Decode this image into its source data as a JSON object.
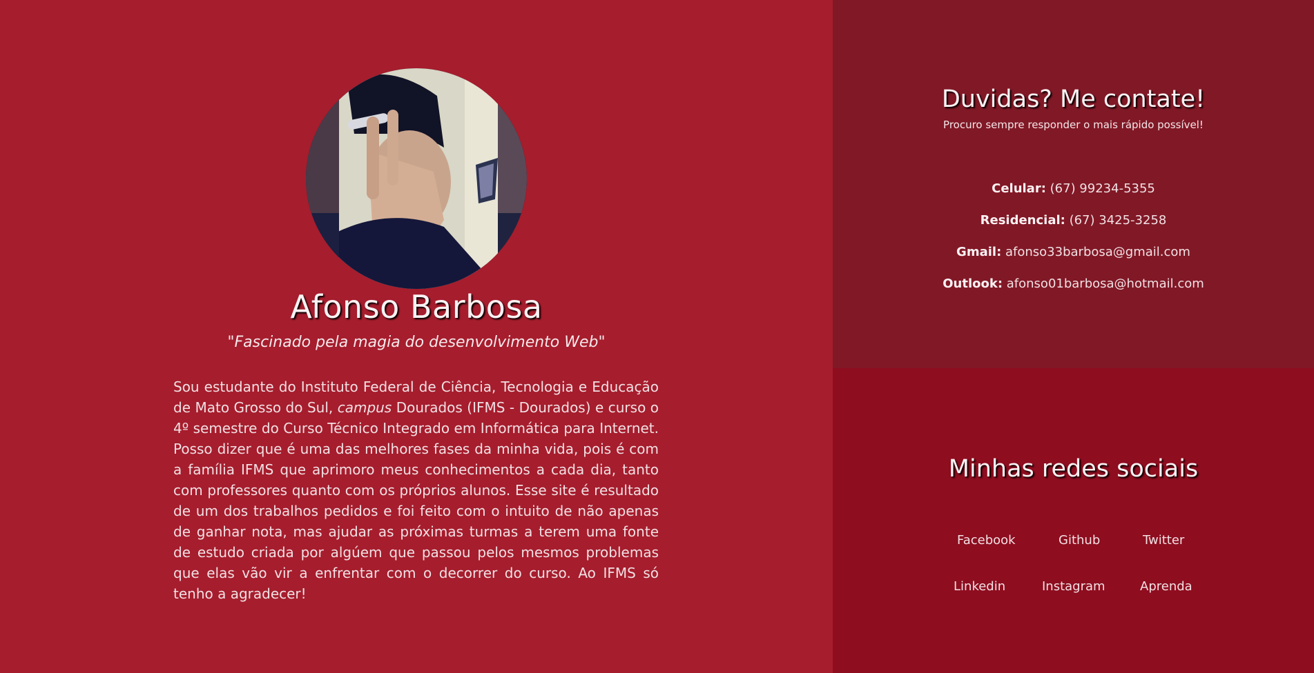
{
  "profile": {
    "name": "Afonso Barbosa",
    "tagline": "\"Fascinado pela magia do desenvolvimento Web\"",
    "bio_part1": "Sou estudante do Instituto Federal de Ciência, Tecnologia e Educação de Mato Grosso do Sul, ",
    "bio_emphasis": "campus",
    "bio_part2": " Dourados (IFMS - Dourados) e curso o 4º semestre do Curso Técnico Integrado em Informática para Internet. Posso dizer que é uma das melhores fases da minha vida, pois é com a família IFMS que aprimoro meus conhecimentos a cada dia, tanto com professores quanto com os próprios alunos. Esse site é resultado de um dos trabalhos pedidos e foi feito com o intuito de não apenas de ganhar nota, mas ajudar as próximas turmas a terem uma fonte de estudo criada por algúem que passou pelos mesmos problemas que elas vão vir a enfrentar com o decorrer do curso. Ao IFMS só tenho a agradecer!"
  },
  "contact": {
    "title": "Duvidas? Me contate!",
    "subtitle": "Procuro sempre responder o mais rápido possível!",
    "celular_label": "Celular:",
    "celular_value": "(67) 99234-5355",
    "residencial_label": "Residencial:",
    "residencial_value": "(67) 3425-3258",
    "gmail_label": "Gmail:",
    "gmail_value": "afonso33barbosa@gmail.com",
    "outlook_label": "Outlook:",
    "outlook_value": "afonso01barbosa@hotmail.com"
  },
  "social": {
    "title": "Minhas redes sociais",
    "facebook": "Facebook",
    "github": "Github",
    "twitter": "Twitter",
    "linkedin": "Linkedin",
    "instagram": "Instagram",
    "aprenda": "Aprenda"
  },
  "colors": {
    "left_bg": "#a61d2d",
    "contact_bg": "#811826",
    "social_bg": "#8e0d1f"
  }
}
